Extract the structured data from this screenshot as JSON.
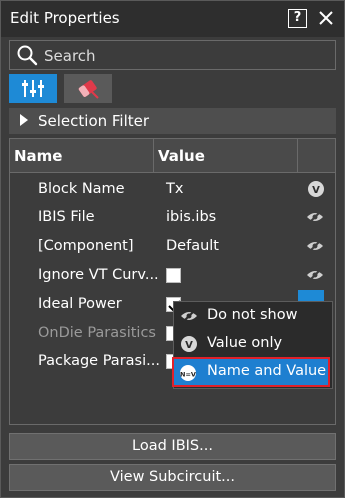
{
  "window": {
    "title": "Edit Properties"
  },
  "search": {
    "placeholder": "Search"
  },
  "filter": {
    "label": "Selection Filter"
  },
  "table": {
    "headers": {
      "name": "Name",
      "value": "Value"
    },
    "rows": [
      {
        "name": "Block Name",
        "value": "Tx",
        "type": "text",
        "icon": "value-only-icon",
        "dim": false
      },
      {
        "name": "IBIS File",
        "value": "ibis.ibs",
        "type": "text",
        "icon": "hidden-eye-icon",
        "dim": false
      },
      {
        "name": "[Component]",
        "value": "Default",
        "type": "text",
        "icon": "hidden-eye-icon",
        "dim": false
      },
      {
        "name": "Ignore VT Curv...",
        "value": "",
        "type": "checkbox",
        "icon": "hidden-eye-icon",
        "dim": false
      },
      {
        "name": "Ideal Power",
        "value": "",
        "type": "checkbox",
        "icon": "",
        "dim": false
      },
      {
        "name": "OnDie Parasitics",
        "value": "",
        "type": "checkbox",
        "icon": "",
        "dim": true
      },
      {
        "name": "Package Parasi...",
        "value": "",
        "type": "checkbox",
        "icon": "",
        "dim": false
      }
    ]
  },
  "popup": {
    "items": [
      {
        "label": "Do not show",
        "icon": "hidden-eye-icon"
      },
      {
        "label": "Value only",
        "icon": "value-only-icon"
      },
      {
        "label": "Name and Value",
        "icon": "name-value-icon"
      }
    ],
    "selected_index": 2
  },
  "buttons": {
    "load_ibis": "Load IBIS...",
    "view_subcircuit": "View Subcircuit..."
  },
  "colors": {
    "accent": "#1e8ad6",
    "highlight_border": "#e0202a",
    "background": "#3c3c3c"
  }
}
